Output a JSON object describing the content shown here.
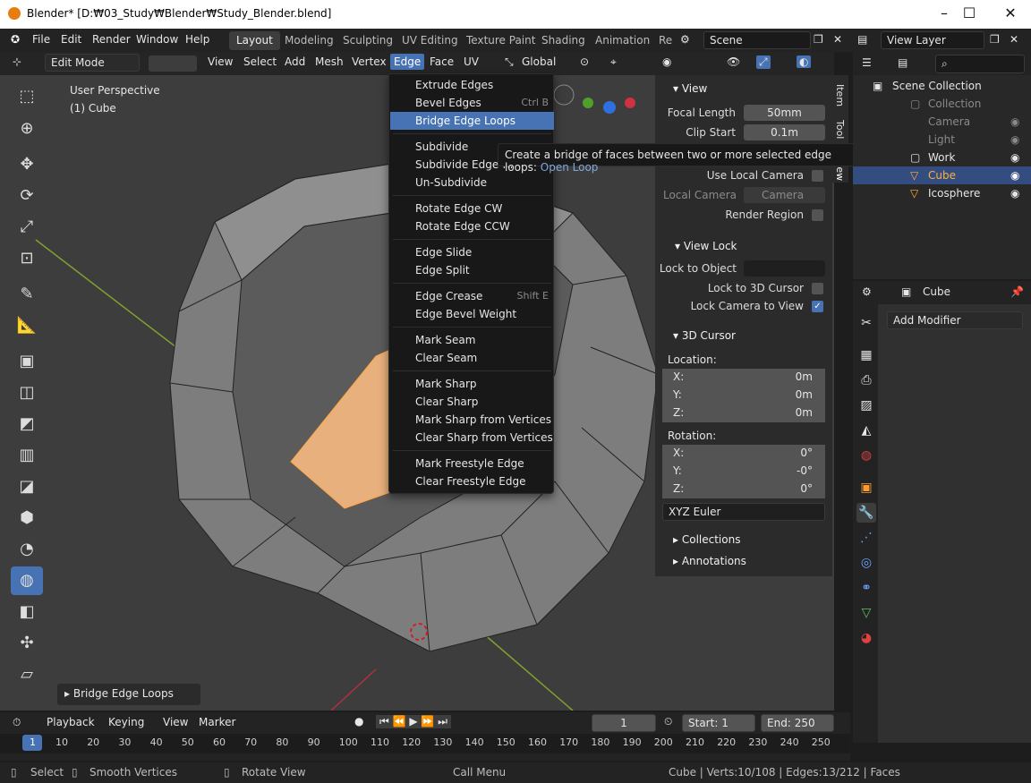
{
  "window": {
    "title": "Blender* [D:₩03_Study₩Blender₩Study_Blender.blend]"
  },
  "topmenu": [
    "File",
    "Edit",
    "Render",
    "Window",
    "Help"
  ],
  "workspaces": [
    "Layout",
    "Modeling",
    "Sculpting",
    "UV Editing",
    "Texture Paint",
    "Shading",
    "Animation",
    "Re"
  ],
  "scene": "Scene",
  "view_layer": "View Layer",
  "header": {
    "mode": "Edit Mode",
    "menus": [
      "View",
      "Select",
      "Add",
      "Mesh",
      "Vertex",
      "Edge",
      "Face",
      "UV"
    ],
    "orientation": "Global"
  },
  "viewport": {
    "persp": "User Perspective",
    "object": "(1) Cube"
  },
  "edge_menu": {
    "items": [
      {
        "label": "Extrude Edges",
        "shortcut": ""
      },
      {
        "label": "Bevel Edges",
        "shortcut": "Ctrl B"
      },
      {
        "label": "Bridge Edge Loops",
        "shortcut": ""
      },
      {
        "label": "Subdivide",
        "shortcut": ""
      },
      {
        "label": "Subdivide Edge-Ri",
        "shortcut": ""
      },
      {
        "label": "Un-Subdivide",
        "shortcut": ""
      },
      {
        "label": "Rotate Edge CW",
        "shortcut": ""
      },
      {
        "label": "Rotate Edge CCW",
        "shortcut": ""
      },
      {
        "label": "Edge Slide",
        "shortcut": ""
      },
      {
        "label": "Edge Split",
        "shortcut": ""
      },
      {
        "label": "Edge Crease",
        "shortcut": "Shift E"
      },
      {
        "label": "Edge Bevel Weight",
        "shortcut": ""
      },
      {
        "label": "Mark Seam",
        "shortcut": ""
      },
      {
        "label": "Clear Seam",
        "shortcut": ""
      },
      {
        "label": "Mark Sharp",
        "shortcut": ""
      },
      {
        "label": "Clear Sharp",
        "shortcut": ""
      },
      {
        "label": "Mark Sharp from Vertices",
        "shortcut": ""
      },
      {
        "label": "Clear Sharp from Vertices",
        "shortcut": ""
      },
      {
        "label": "Mark Freestyle Edge",
        "shortcut": ""
      },
      {
        "label": "Clear Freestyle Edge",
        "shortcut": ""
      }
    ]
  },
  "tooltip": {
    "text": "Create a bridge of faces between two or more selected edge loops:",
    "action": "Open Loop"
  },
  "npanel": {
    "tabs": [
      "Item",
      "Tool",
      "View"
    ],
    "view_title": "View",
    "focal_label": "Focal Length",
    "focal": "50mm",
    "clip_label": "Clip Start",
    "clip": "0.1m",
    "local_cam_use": "Use Local Camera",
    "local_cam": "Local Camera",
    "camera": "Camera",
    "render_region": "Render Region",
    "view_lock": "View Lock",
    "lock_obj": "Lock to Object",
    "lock_cursor": "Lock to 3D Cursor",
    "lock_cam": "Lock Camera to View",
    "cursor_title": "3D Cursor",
    "location": "Location:",
    "rotation": "Rotation:",
    "loc": [
      {
        "axis": "X:",
        "v": "0m"
      },
      {
        "axis": "Y:",
        "v": "0m"
      },
      {
        "axis": "Z:",
        "v": "0m"
      }
    ],
    "rot": [
      {
        "axis": "X:",
        "v": "0°"
      },
      {
        "axis": "Y:",
        "v": "-0°"
      },
      {
        "axis": "Z:",
        "v": "0°"
      }
    ],
    "euler": "XYZ Euler",
    "collections": "Collections",
    "annotations": "Annotations"
  },
  "outliner": {
    "rows": [
      "Scene Collection",
      "Collection",
      "Camera",
      "Light",
      "Work",
      "Cube",
      "Icosphere"
    ]
  },
  "properties": {
    "object": "Cube",
    "add_modifier": "Add Modifier"
  },
  "timeline": {
    "menus": [
      "Playback",
      "Keying",
      "View",
      "Marker"
    ],
    "frame": "1",
    "start_label": "Start:",
    "start": "1",
    "end_label": "End:",
    "end": "250",
    "ticks": [
      "1",
      "10",
      "20",
      "30",
      "40",
      "50",
      "60",
      "70",
      "80",
      "90",
      "100",
      "110",
      "120",
      "130",
      "140",
      "150",
      "160",
      "170",
      "180",
      "190",
      "200",
      "210",
      "220",
      "230",
      "240",
      "250"
    ]
  },
  "last_op": "Bridge Edge Loops",
  "status": {
    "select": "Select",
    "smooth": "Smooth Vertices",
    "rotate": "Rotate View",
    "call": "Call Menu",
    "stats": "Cube | Verts:10/108 | Edges:13/212 | Faces"
  },
  "colors": {
    "accent": "#4772b3",
    "selection": "#ffa640"
  }
}
